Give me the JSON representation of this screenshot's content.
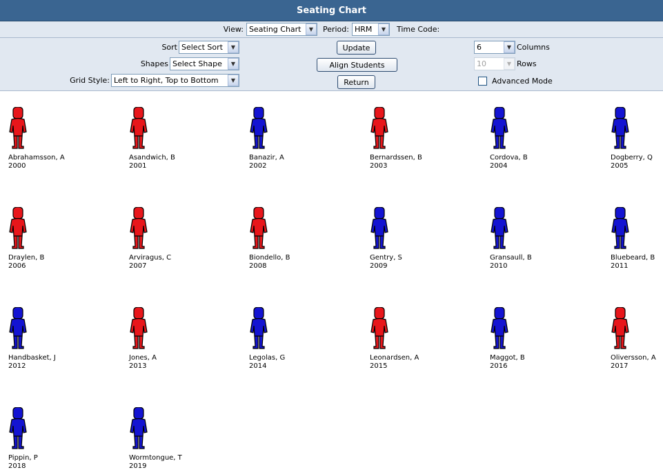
{
  "header": {
    "title": "Seating Chart"
  },
  "viewbar": {
    "view_label": "View:",
    "view_value": "Seating Chart",
    "period_label": "Period:",
    "period_value": "HRM",
    "timecode_label": "Time Code:"
  },
  "controls": {
    "sort_label": "Sort",
    "sort_value": "Select Sort",
    "shapes_label": "Shapes",
    "shapes_value": "Select Shape",
    "gridstyle_label": "Grid Style:",
    "gridstyle_value": "Left to Right, Top to Bottom",
    "update_button": "Update",
    "align_button": "Align Students",
    "return_button": "Return",
    "columns_value": "6",
    "columns_label": "Columns",
    "rows_value": "10",
    "rows_label": "Rows",
    "advanced_label": "Advanced Mode",
    "advanced_checked": false
  },
  "colors": {
    "red": "#e8161b",
    "blue": "#1414d2",
    "header": "#3a6591",
    "panel": "#e1e8f1"
  },
  "students": [
    {
      "name": "Abrahamsson, A",
      "id": "2000",
      "color": "red"
    },
    {
      "name": "Asandwich, B",
      "id": "2001",
      "color": "red"
    },
    {
      "name": "Banazir, A",
      "id": "2002",
      "color": "blue"
    },
    {
      "name": "Bernardssen, B",
      "id": "2003",
      "color": "red"
    },
    {
      "name": "Cordova, B",
      "id": "2004",
      "color": "blue"
    },
    {
      "name": "Dogberry, Q",
      "id": "2005",
      "color": "blue"
    },
    {
      "name": "Draylen, B",
      "id": "2006",
      "color": "red"
    },
    {
      "name": "Arviragus, C",
      "id": "2007",
      "color": "red"
    },
    {
      "name": "Biondello, B",
      "id": "2008",
      "color": "red"
    },
    {
      "name": "Gentry, S",
      "id": "2009",
      "color": "blue"
    },
    {
      "name": "Gransaull, B",
      "id": "2010",
      "color": "blue"
    },
    {
      "name": "Bluebeard, B",
      "id": "2011",
      "color": "blue"
    },
    {
      "name": "Handbasket, J",
      "id": "2012",
      "color": "blue"
    },
    {
      "name": "Jones, A",
      "id": "2013",
      "color": "red"
    },
    {
      "name": "Legolas, G",
      "id": "2014",
      "color": "blue"
    },
    {
      "name": "Leonardsen, A",
      "id": "2015",
      "color": "red"
    },
    {
      "name": "Maggot, B",
      "id": "2016",
      "color": "blue"
    },
    {
      "name": "Oliversson, A",
      "id": "2017",
      "color": "red"
    },
    {
      "name": "Pippin, P",
      "id": "2018",
      "color": "blue"
    },
    {
      "name": "Wormtongue, T",
      "id": "2019",
      "color": "blue"
    }
  ]
}
